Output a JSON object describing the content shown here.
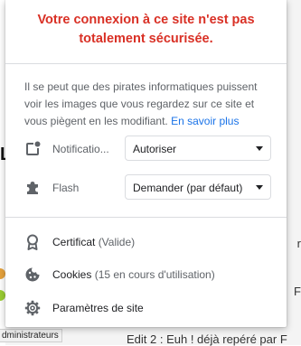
{
  "popup": {
    "title": "Votre connexion à ce site n'est pas totalement sécurisée.",
    "description": "Il se peut que des pirates informatiques puissent voir les images que vous regardez sur ce site et vous piègent en les modifiant.",
    "learn_more": "En savoir plus",
    "permissions": [
      {
        "label": "Notificatio...",
        "value": "Autoriser",
        "icon": "notification-icon"
      },
      {
        "label": "Flash",
        "value": "Demander (par défaut)",
        "icon": "puzzle-icon"
      }
    ],
    "info_items": [
      {
        "label": "Certificat",
        "sub": "(Valide)",
        "icon": "certificate-icon"
      },
      {
        "label": "Cookies",
        "sub": "(15 en cours d'utilisation)",
        "icon": "cookie-icon"
      },
      {
        "label": "Paramètres de site",
        "sub": "",
        "icon": "gear-icon"
      }
    ]
  },
  "background": {
    "left_glyph": "L",
    "admin_chip": "dministrateurs",
    "right_chars": [
      "r",
      "F"
    ],
    "bottom_text": "Edit 2 : Euh ! déjà repéré par F"
  },
  "colors": {
    "warning_red": "#d93025",
    "link_blue": "#1a73e8",
    "secondary_text": "#5f6368",
    "divider": "#dadce0"
  }
}
